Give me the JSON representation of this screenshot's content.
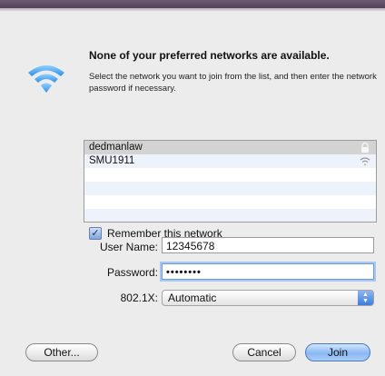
{
  "dialog": {
    "heading": "None of your preferred networks are available.",
    "description": "Select the network you want to join from the list, and then enter the network password if necessary.",
    "icon": "wifi-icon"
  },
  "networks": [
    {
      "name": "dedmanlaw",
      "icon": "lock-icon",
      "selected": true
    },
    {
      "name": "SMU1911",
      "icon": "wifi-signal-icon",
      "selected": false
    }
  ],
  "remember": {
    "label": "Remember this network",
    "checked": true
  },
  "form": {
    "username_label": "User Name:",
    "username_value": "12345678",
    "password_label": "Password:",
    "password_value": "••••••••",
    "auth_label": "802.1X:",
    "auth_value": "Automatic"
  },
  "buttons": {
    "other": "Other...",
    "cancel": "Cancel",
    "join": "Join"
  }
}
